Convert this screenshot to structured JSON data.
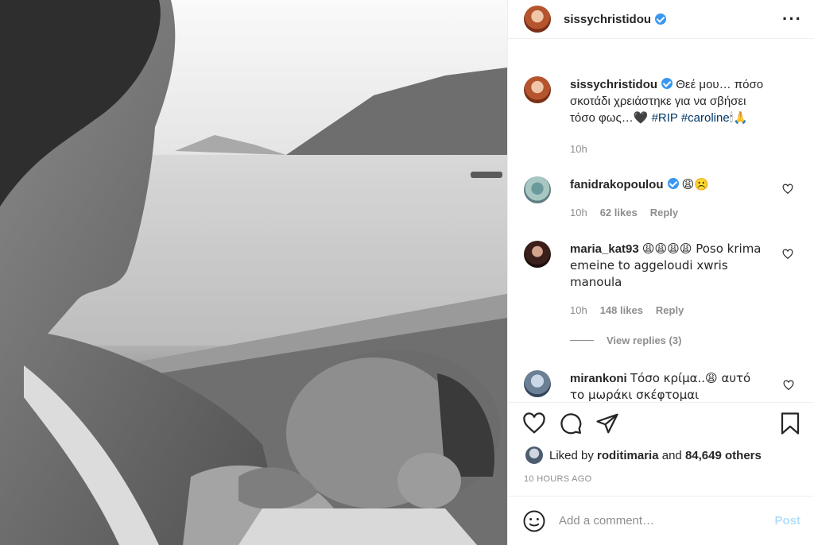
{
  "post": {
    "author": "sissychristidou",
    "caption": "Θεέ μου… πόσο σκοτάδι χρειάστηκε για να σβήσει τόσο φως…",
    "caption_emoji": "🖤",
    "hashtags": [
      "#RIP",
      "#caroline"
    ],
    "caption_end_emoji": "🕯🙏",
    "caption_time": "10h"
  },
  "comments": [
    {
      "user": "fanidrakopoulou",
      "verified": true,
      "text": "😩☹️",
      "time": "10h",
      "likes": "62 likes",
      "reply": "Reply"
    },
    {
      "user": "maria_kat93",
      "verified": false,
      "text": "😩😩😩😩 Poso krima emeine to aggeloudi xwris manoula",
      "time": "10h",
      "likes": "148 likes",
      "reply": "Reply",
      "view_replies": "View replies (3)"
    },
    {
      "user": "mirankoni",
      "verified": false,
      "text": "Τόσο κρίμα..😩 αυτό το μωράκι σκέφτομαι"
    }
  ],
  "likes": {
    "prefix": "Liked by",
    "user": "roditimaria",
    "mid": "and",
    "count": "84,649 others"
  },
  "timestamp": "10 HOURS AGO",
  "add_comment": {
    "placeholder": "Add a comment…",
    "post_label": "Post"
  },
  "icons": [
    "more-icon",
    "heart-icon",
    "comment-icon",
    "share-icon",
    "bookmark-icon",
    "emoji-icon"
  ],
  "colors": {
    "verified": "#3897f0",
    "hashtag": "#00376b",
    "muted": "#8e8e8e",
    "post_disabled": "#b2dffc"
  }
}
